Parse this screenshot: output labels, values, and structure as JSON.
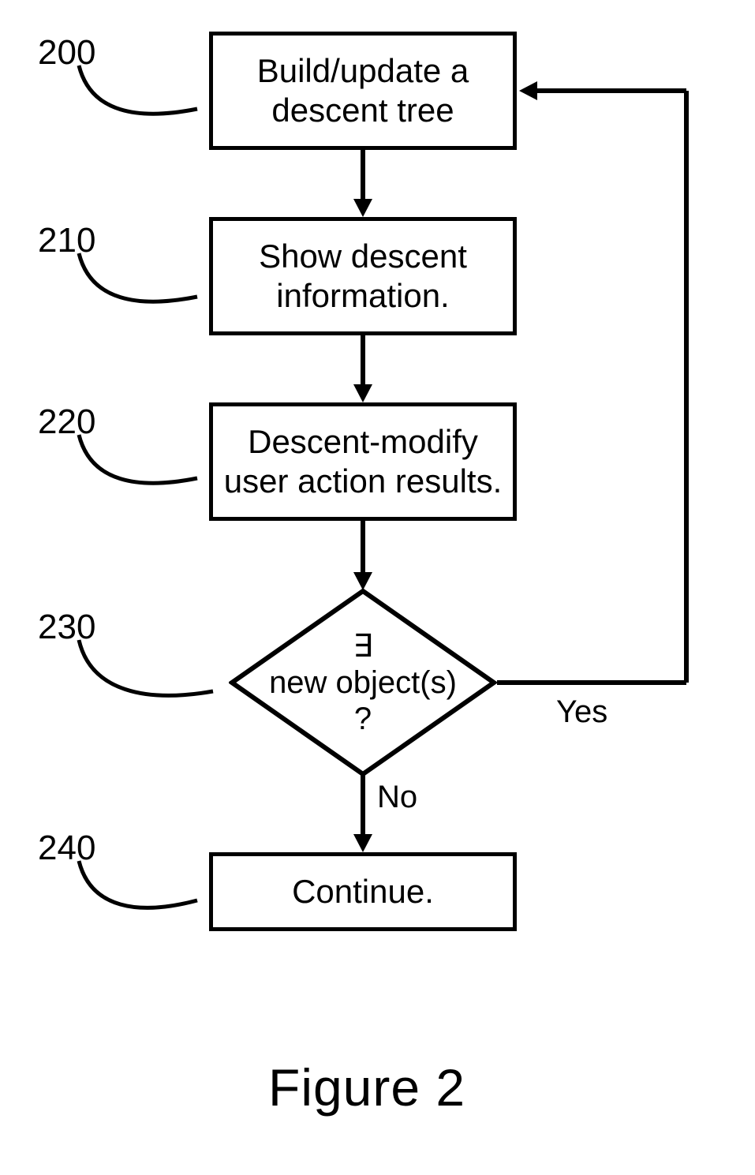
{
  "steps": {
    "s200": {
      "num": "200",
      "text": "Build/update a\ndescent tree"
    },
    "s210": {
      "num": "210",
      "text": "Show descent\ninformation."
    },
    "s220": {
      "num": "220",
      "text": "Descent-modify\nuser action results."
    },
    "s230": {
      "num": "230",
      "text": "∃\nnew object(s)\n?"
    },
    "s240": {
      "num": "240",
      "text": "Continue."
    }
  },
  "edges": {
    "yes": "Yes",
    "no": "No"
  },
  "caption": "Figure 2"
}
